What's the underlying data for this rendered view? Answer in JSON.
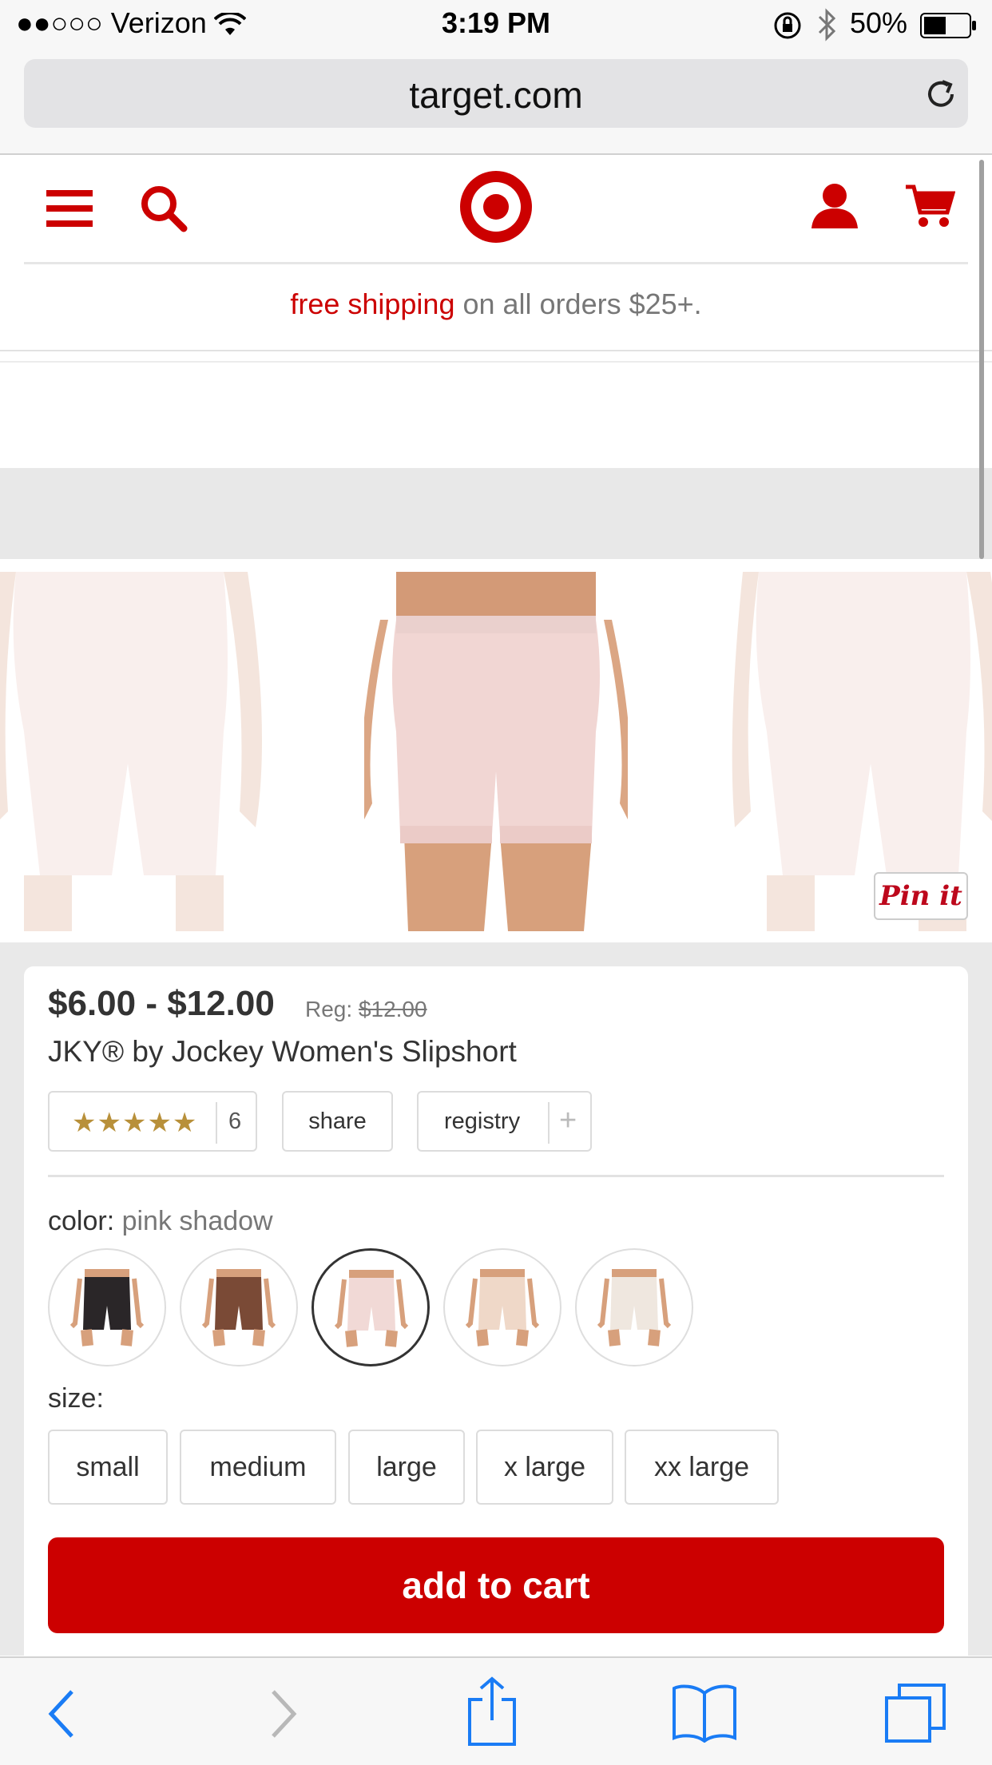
{
  "status_bar": {
    "carrier": "●●○○○ Verizon",
    "time": "3:19 PM",
    "battery": "50%"
  },
  "browser": {
    "url": "target.com"
  },
  "header": {
    "icons": [
      "menu-icon",
      "search-icon",
      "target-logo",
      "account-icon",
      "cart-icon"
    ]
  },
  "promo": {
    "highlight": "free shipping",
    "rest": " on all orders $25+."
  },
  "pinit": {
    "label": "Pin it"
  },
  "product": {
    "price_range": "$6.00 - $12.00",
    "reg_label": "Reg:",
    "reg_price": "$12.00",
    "title": "JKY® by Jockey Women's Slipshort",
    "rating_stars": "★★★★★",
    "rating_count": "6",
    "share_label": "share",
    "registry_label": "registry",
    "registry_plus": "+",
    "color_label": "color:",
    "color_value": "pink shadow",
    "swatches": [
      {
        "color": "#2a2628"
      },
      {
        "color": "#7a4a36"
      },
      {
        "color": "#f1d9d6"
      },
      {
        "color": "#efd8c8"
      },
      {
        "color": "#efe7df"
      }
    ],
    "size_label": "size:",
    "sizes": [
      "small",
      "medium",
      "large",
      "x large",
      "xx large"
    ],
    "add_to_cart": "add to cart"
  },
  "colors": {
    "brand_red": "#cc0000",
    "ios_blue": "#1a7cf5"
  }
}
